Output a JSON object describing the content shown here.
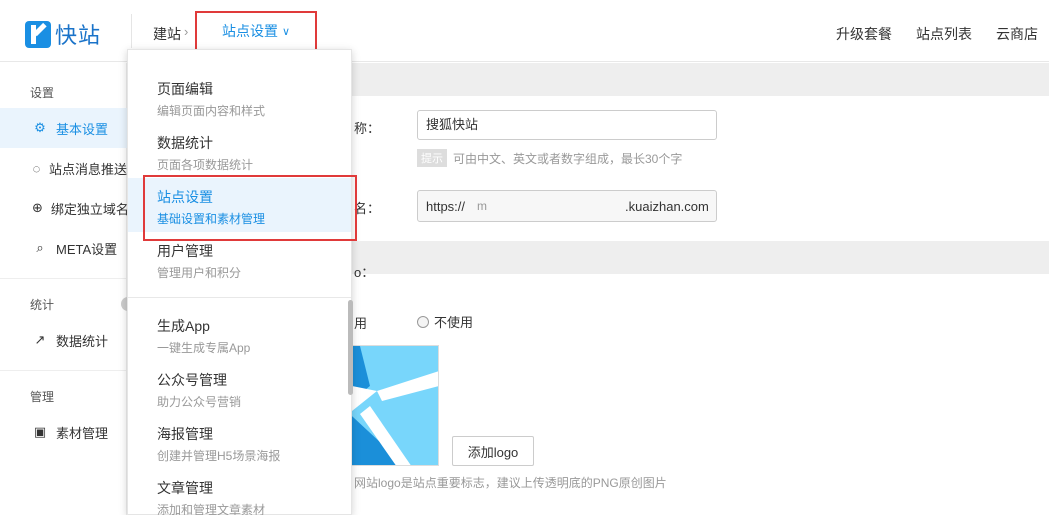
{
  "header": {
    "logo_text": "快站",
    "breadcrumb_root": "建站",
    "breadcrumb_current": "站点设置",
    "nav": [
      "升级套餐",
      "站点列表",
      "云商店"
    ]
  },
  "sidebar": {
    "groups": [
      {
        "title": "设置",
        "items": [
          {
            "label": "基本设置",
            "icon": "gear-icon",
            "active": true
          },
          {
            "label": "站点消息推送",
            "icon": "chat-icon",
            "active": false
          },
          {
            "label": "绑定独立域名",
            "icon": "globe-icon",
            "active": false
          },
          {
            "label": "META设置",
            "icon": "search-icon",
            "active": false
          }
        ]
      },
      {
        "title": "统计",
        "items": [
          {
            "label": "数据统计",
            "icon": "chart-icon",
            "active": false
          }
        ]
      },
      {
        "title": "管理",
        "items": [
          {
            "label": "素材管理",
            "icon": "image-icon",
            "active": false
          }
        ]
      }
    ]
  },
  "main": {
    "name_label_fragment": "称：",
    "name_value": "搜狐快站",
    "hint_tag": "提示",
    "hint_text": "可由中文、英文或者数字组成，最长30个字",
    "domain_label_fragment": "名：",
    "domain_prefix": "https://",
    "domain_value": "m",
    "domain_suffix": ".kuaizhan.com",
    "logo_section_fragment": "o：",
    "radio_use_fragment": "用",
    "radio_not_use": "不使用",
    "add_logo_button": "添加logo",
    "logo_note": "网站logo是站点重要标志，建议上传透明底的PNG原创图片"
  },
  "dropdown": {
    "items": [
      {
        "title": "页面编辑",
        "sub": "编辑页面内容和样式",
        "active": false
      },
      {
        "title": "数据统计",
        "sub": "页面各项数据统计",
        "active": false
      },
      {
        "title": "站点设置",
        "sub": "基础设置和素材管理",
        "active": true
      },
      {
        "title": "用户管理",
        "sub": "管理用户和积分",
        "active": false
      },
      {
        "title": "生成App",
        "sub": "一键生成专属App",
        "active": false
      },
      {
        "title": "公众号管理",
        "sub": "助力公众号营销",
        "active": false
      },
      {
        "title": "海报管理",
        "sub": "创建并管理H5场景海报",
        "active": false
      },
      {
        "title": "文章管理",
        "sub": "添加和管理文章素材",
        "active": false
      }
    ]
  },
  "colors": {
    "accent": "#1a8fe3",
    "highlight_border": "#e03a3a",
    "active_bg": "#eaf4fd"
  }
}
